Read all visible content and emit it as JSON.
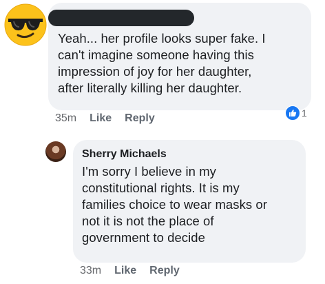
{
  "comment1": {
    "text": "Yeah... her profile looks super fake. I\ncan't imagine someone having this\nimpression of joy for her daughter,\nafter literally killing her daughter.",
    "time": "35m",
    "like_label": "Like",
    "reply_label": "Reply",
    "reaction_count": "1",
    "avatar_icon": "sunglasses-emoji-icon",
    "reaction_icon": "thumbs-up-icon"
  },
  "comment2": {
    "author": "Sherry Michaels",
    "text": "I'm sorry I believe in my\nconstitutional rights. It is my\nfamilies choice to wear masks or\nnot it is not the place of\ngovernment to decide",
    "time": "33m",
    "like_label": "Like",
    "reply_label": "Reply"
  },
  "colors": {
    "bubble_bg": "#f0f2f5",
    "reaction_blue": "#1877f2",
    "meta_gray": "#606770",
    "redaction": "#23272b"
  }
}
